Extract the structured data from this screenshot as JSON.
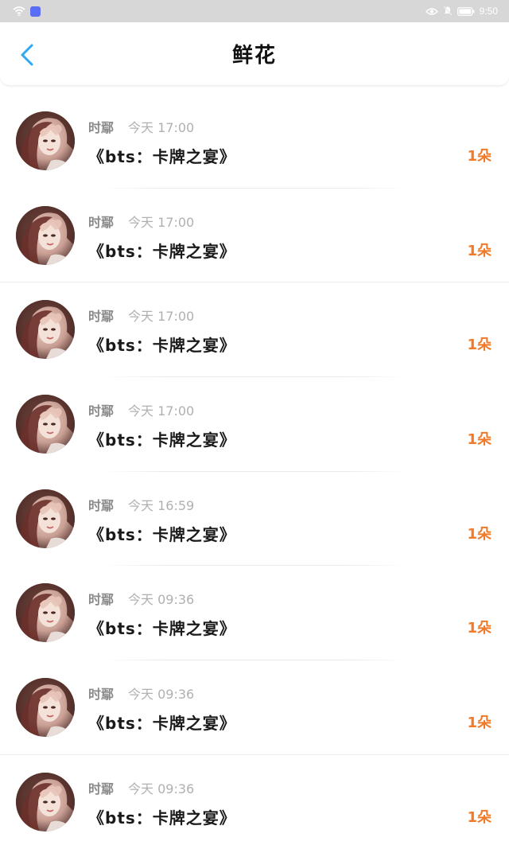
{
  "status_bar": {
    "time": "9:50",
    "icons": [
      "wifi-icon",
      "app-badge-icon",
      "eye-icon",
      "mute-icon",
      "battery-icon"
    ]
  },
  "header": {
    "title": "鲜花",
    "back_icon": "chevron-left-icon"
  },
  "colors": {
    "accent_blue": "#2ea7f5",
    "count_orange": "#f07a2a"
  },
  "records": [
    {
      "sender": "时鄢",
      "time": "今天 17:00",
      "book": "《bts：卡牌之宴》",
      "count": "1朵"
    },
    {
      "sender": "时鄢",
      "time": "今天 17:00",
      "book": "《bts：卡牌之宴》",
      "count": "1朵"
    },
    {
      "sender": "时鄢",
      "time": "今天 17:00",
      "book": "《bts：卡牌之宴》",
      "count": "1朵"
    },
    {
      "sender": "时鄢",
      "time": "今天 17:00",
      "book": "《bts：卡牌之宴》",
      "count": "1朵"
    },
    {
      "sender": "时鄢",
      "time": "今天 16:59",
      "book": "《bts：卡牌之宴》",
      "count": "1朵"
    },
    {
      "sender": "时鄢",
      "time": "今天 09:36",
      "book": "《bts：卡牌之宴》",
      "count": "1朵"
    },
    {
      "sender": "时鄢",
      "time": "今天 09:36",
      "book": "《bts：卡牌之宴》",
      "count": "1朵"
    },
    {
      "sender": "时鄢",
      "time": "今天 09:36",
      "book": "《bts：卡牌之宴》",
      "count": "1朵"
    }
  ]
}
